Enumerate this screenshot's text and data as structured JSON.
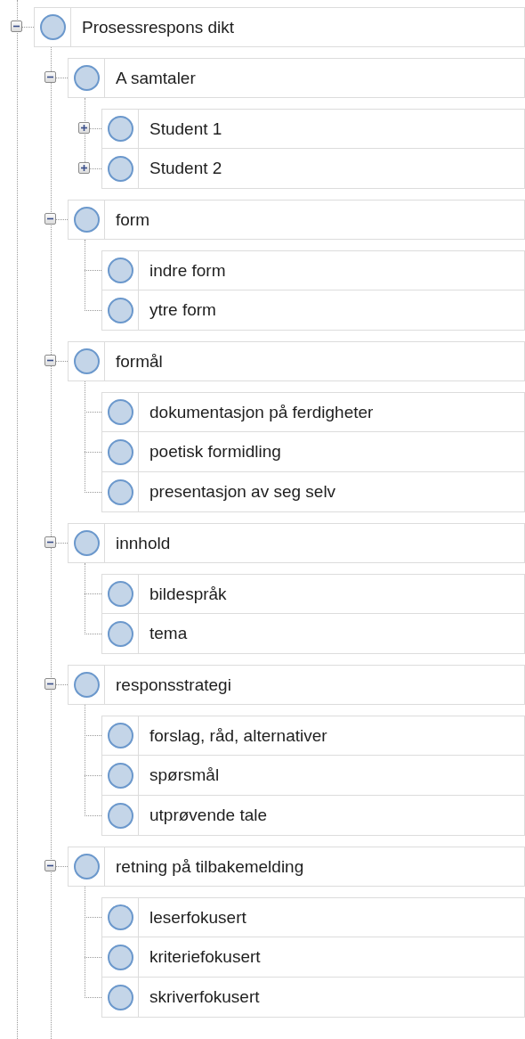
{
  "tree": [
    {
      "label": "Prosessrespons dikt",
      "expanded": true,
      "children": [
        {
          "label": "A samtaler",
          "expanded": true,
          "children": [
            {
              "label": "Student 1",
              "expanded": false
            },
            {
              "label": "Student 2",
              "expanded": false
            }
          ]
        },
        {
          "label": "form",
          "expanded": true,
          "children": [
            {
              "label": "indre form"
            },
            {
              "label": "ytre form"
            }
          ]
        },
        {
          "label": "formål",
          "expanded": true,
          "children": [
            {
              "label": "dokumentasjon på ferdigheter"
            },
            {
              "label": "poetisk formidling"
            },
            {
              "label": "presentasjon av seg selv"
            }
          ]
        },
        {
          "label": "innhold",
          "expanded": true,
          "children": [
            {
              "label": "bildespråk"
            },
            {
              "label": "tema"
            }
          ]
        },
        {
          "label": "responsstrategi",
          "expanded": true,
          "children": [
            {
              "label": "forslag, råd, alternativer"
            },
            {
              "label": "spørsmål"
            },
            {
              "label": "utprøvende tale"
            }
          ]
        },
        {
          "label": "retning på tilbakemelding",
          "expanded": true,
          "children": [
            {
              "label": "leserfokusert"
            },
            {
              "label": "kriteriefokusert"
            },
            {
              "label": "skriverfokusert"
            }
          ]
        }
      ]
    }
  ]
}
